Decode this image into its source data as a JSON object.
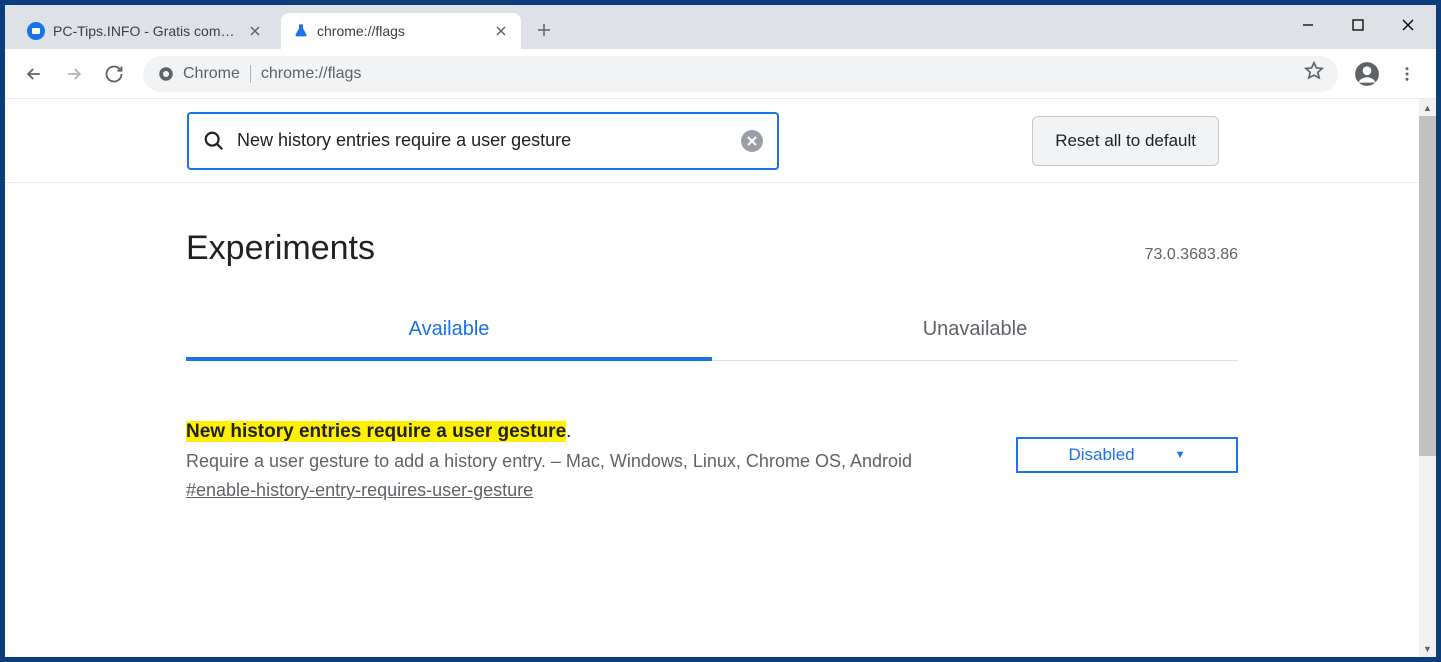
{
  "tabs": [
    {
      "title": "PC-Tips.INFO - Gratis computer t"
    },
    {
      "title": "chrome://flags"
    }
  ],
  "active_tab": 1,
  "omnibox": {
    "chip": "Chrome",
    "url": "chrome://flags"
  },
  "search": {
    "value": "New history entries require a user gesture",
    "reset_label": "Reset all to default"
  },
  "page_title": "Experiments",
  "version": "73.0.3683.86",
  "exp_tabs": {
    "available": "Available",
    "unavailable": "Unavailable"
  },
  "flag": {
    "title_hl": "New history entries require a user gesture",
    "title_tail": ".",
    "description": "Require a user gesture to add a history entry. – Mac, Windows, Linux, Chrome OS, Android",
    "anchor": "#enable-history-entry-requires-user-gesture",
    "select_value": "Disabled"
  }
}
